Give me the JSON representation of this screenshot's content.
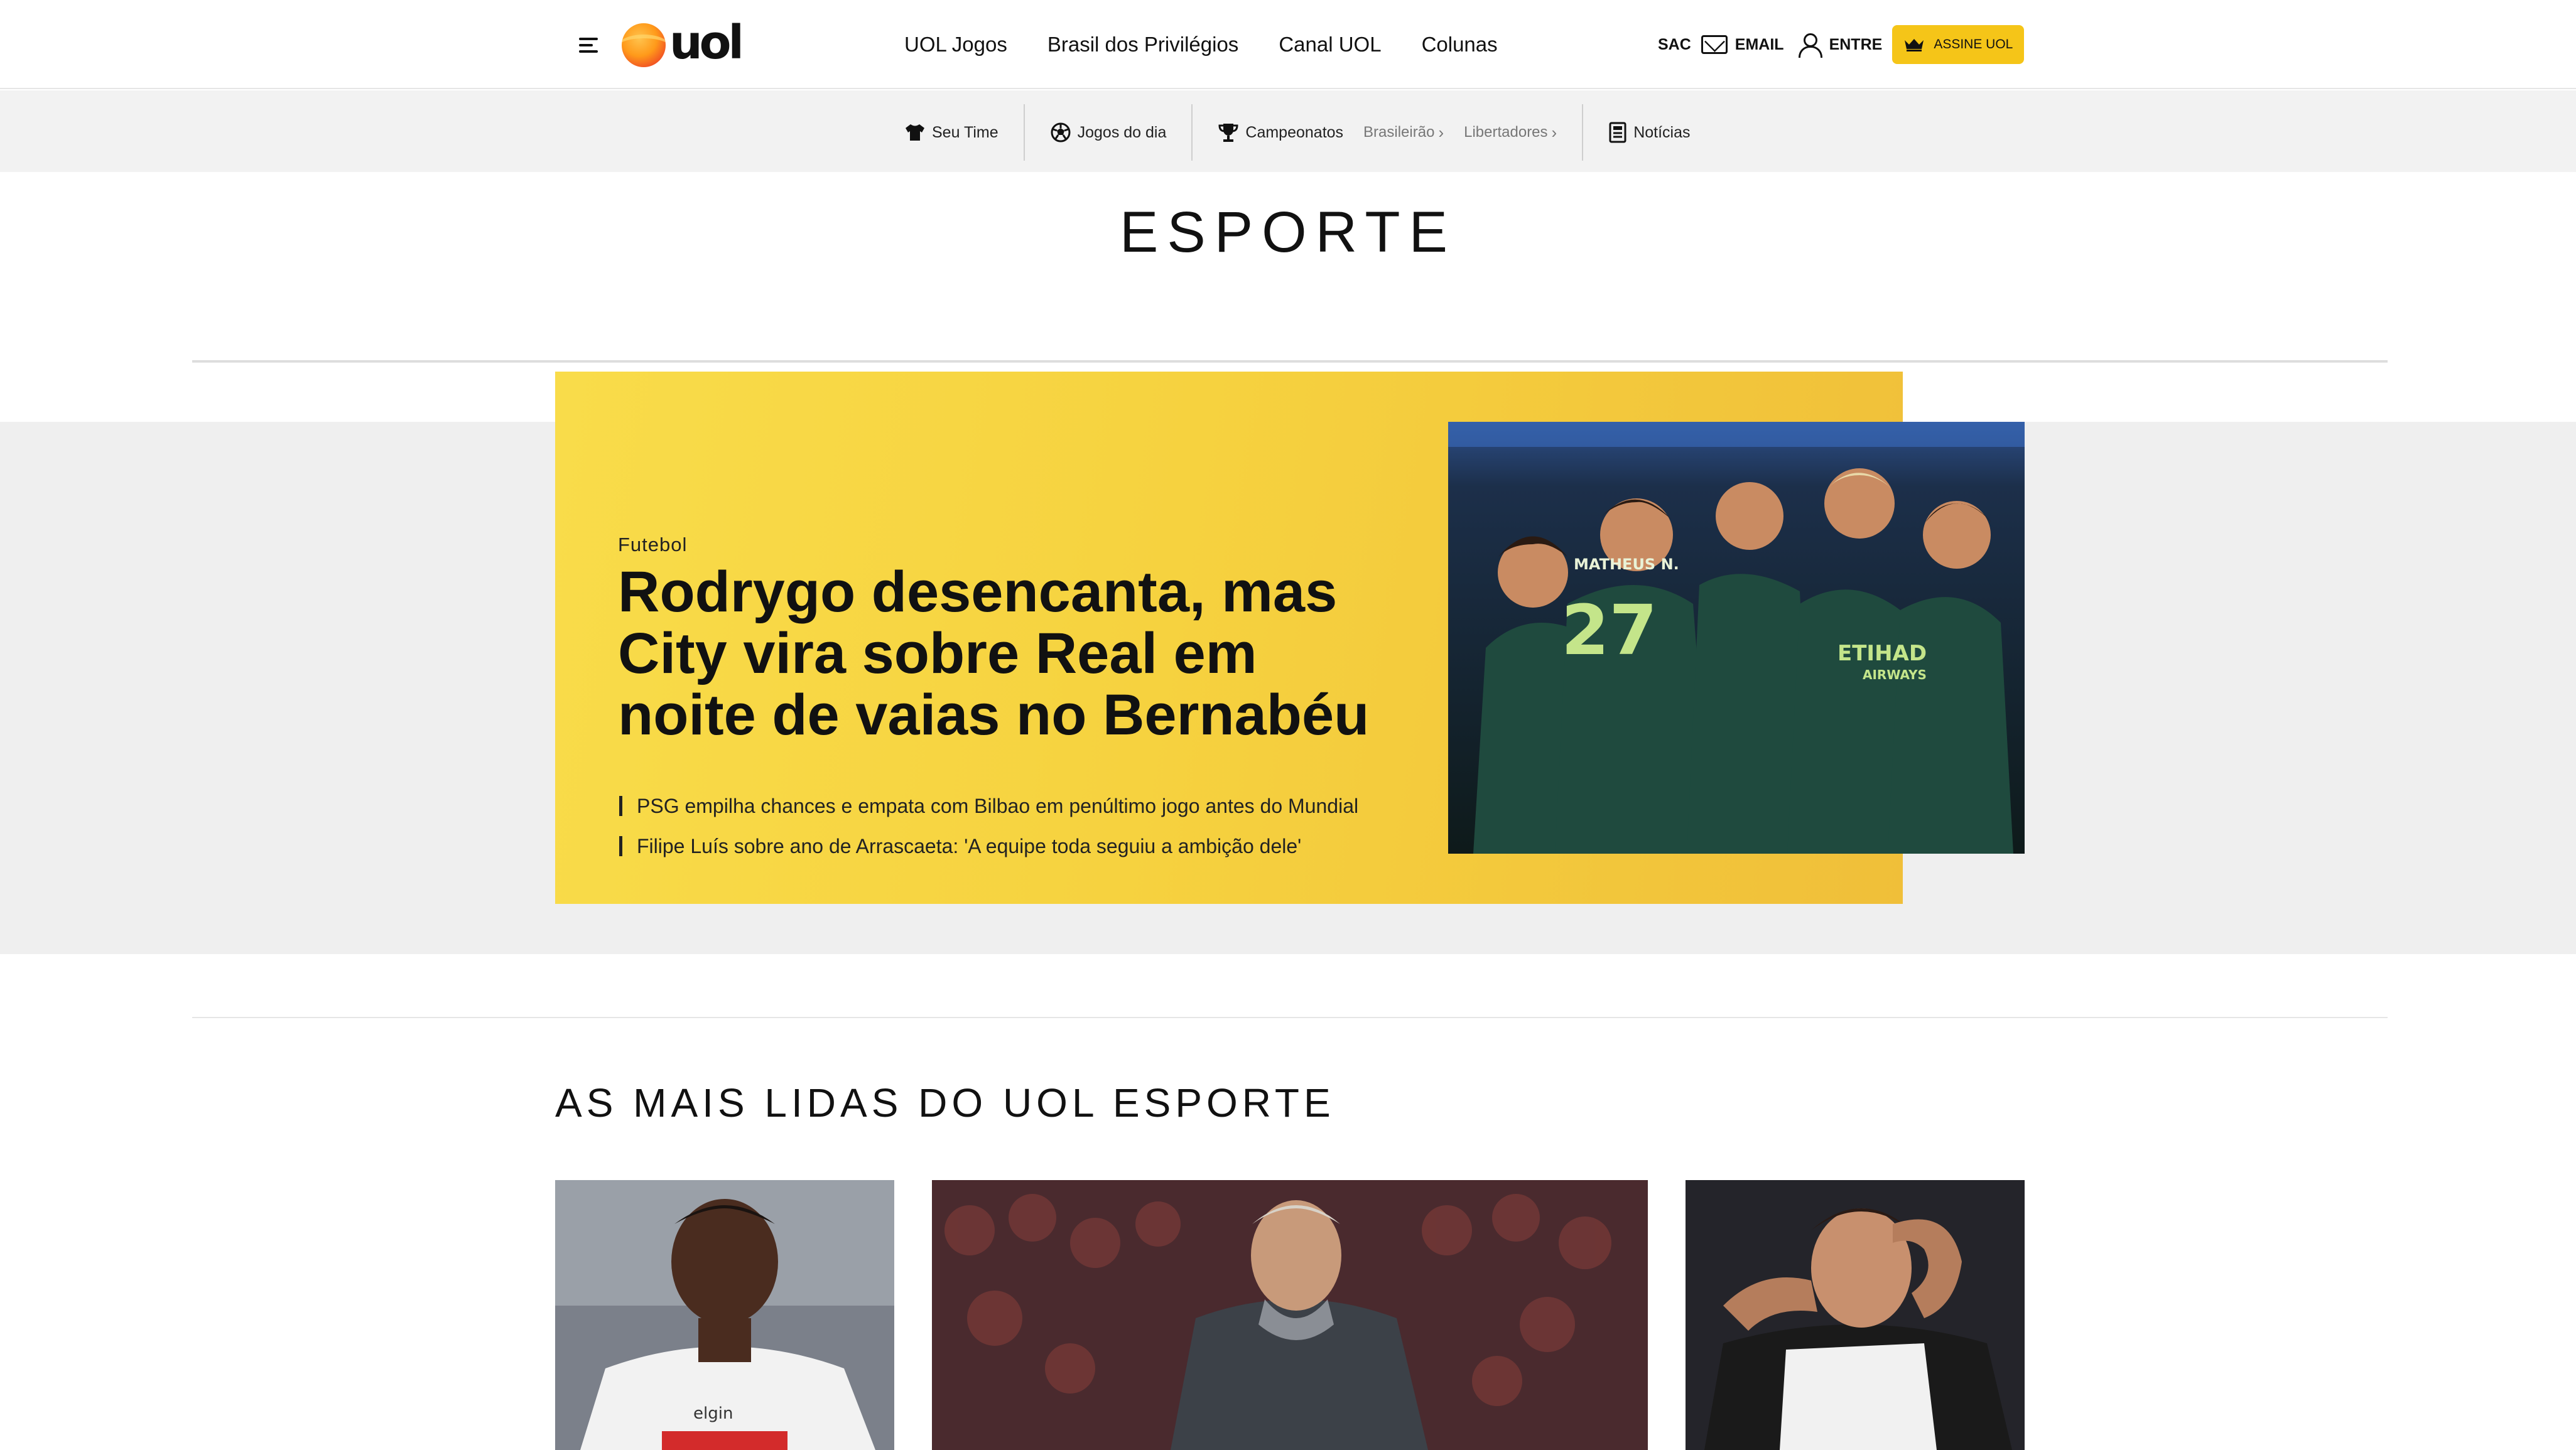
{
  "header": {
    "logo_text": "uol",
    "nav": [
      "UOL Jogos",
      "Brasil dos Privilégios",
      "Canal UOL",
      "Colunas"
    ],
    "sac_label": "SAC",
    "email_label": "EMAIL",
    "login_label": "ENTRE",
    "subscribe_label": "ASSINE UOL",
    "accent_color": "#f5c518"
  },
  "subnav": {
    "seu_time": "Seu Time",
    "jogos_do_dia": "Jogos do dia",
    "campeonatos": "Campeonatos",
    "brasileirao": "Brasileirão",
    "libertadores": "Libertadores",
    "noticias": "Notícias"
  },
  "page": {
    "title": "ESPORTE"
  },
  "hero": {
    "kicker": "Futebol",
    "headline": "Rodrygo desencanta, mas City vira sobre Real em noite de vaias no Bernabéu",
    "related": [
      "PSG empilha chances e empata com Bilbao em penúltimo jogo antes do Mundial",
      "Filipe Luís sobre ano de Arrascaeta: 'A equipe toda seguiu a ambição dele'"
    ],
    "photo_text": "MATHEUS N. 27"
  },
  "most_read": {
    "title": "AS MAIS LIDAS DO UOL ESPORTE"
  }
}
